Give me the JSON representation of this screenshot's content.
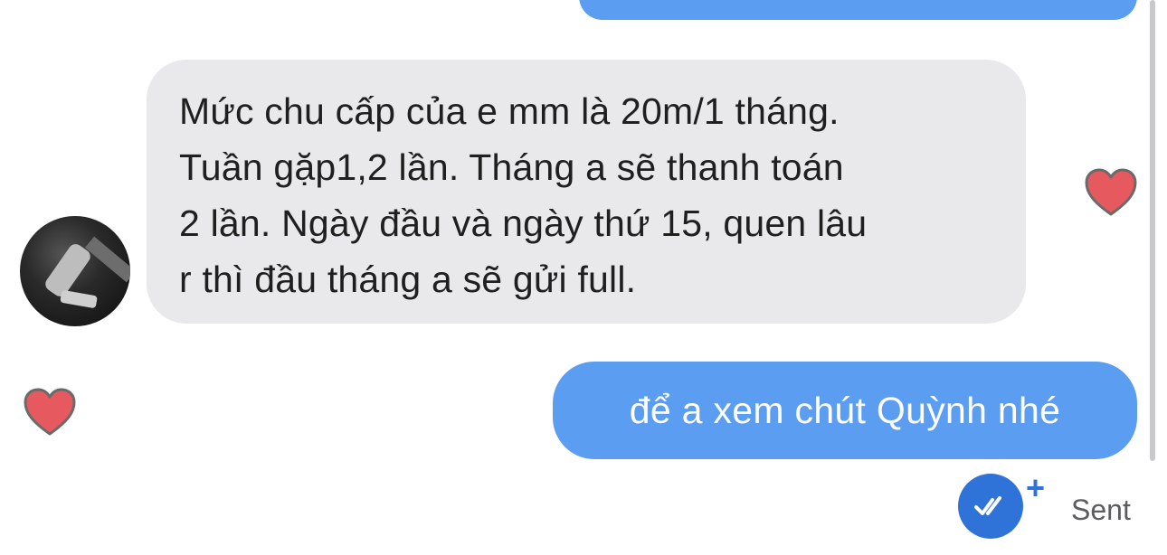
{
  "conversation": {
    "received_message": "Mức chu cấp của e mm là 20m/1 tháng.\nTuần gặp1,2 lần. Tháng a sẽ thanh toán\n2 lần. Ngày đầu và ngày thứ 15, quen lâu\nr thì đầu tháng a sẽ gửi full.",
    "sent_message": "để a xem chút Quỳnh nhé",
    "status": {
      "label": "Sent",
      "plus_symbol": "+"
    },
    "icons": {
      "reaction": "heart-icon",
      "read_receipt": "double-check-icon",
      "avatar": "avatar"
    }
  },
  "colors": {
    "sent_bubble": "#5b9df1",
    "received_bubble": "#e9e9ec",
    "heart_fill": "#e65a5f",
    "heart_stroke": "#6a6a6a",
    "status_accent": "#2f73d9"
  }
}
